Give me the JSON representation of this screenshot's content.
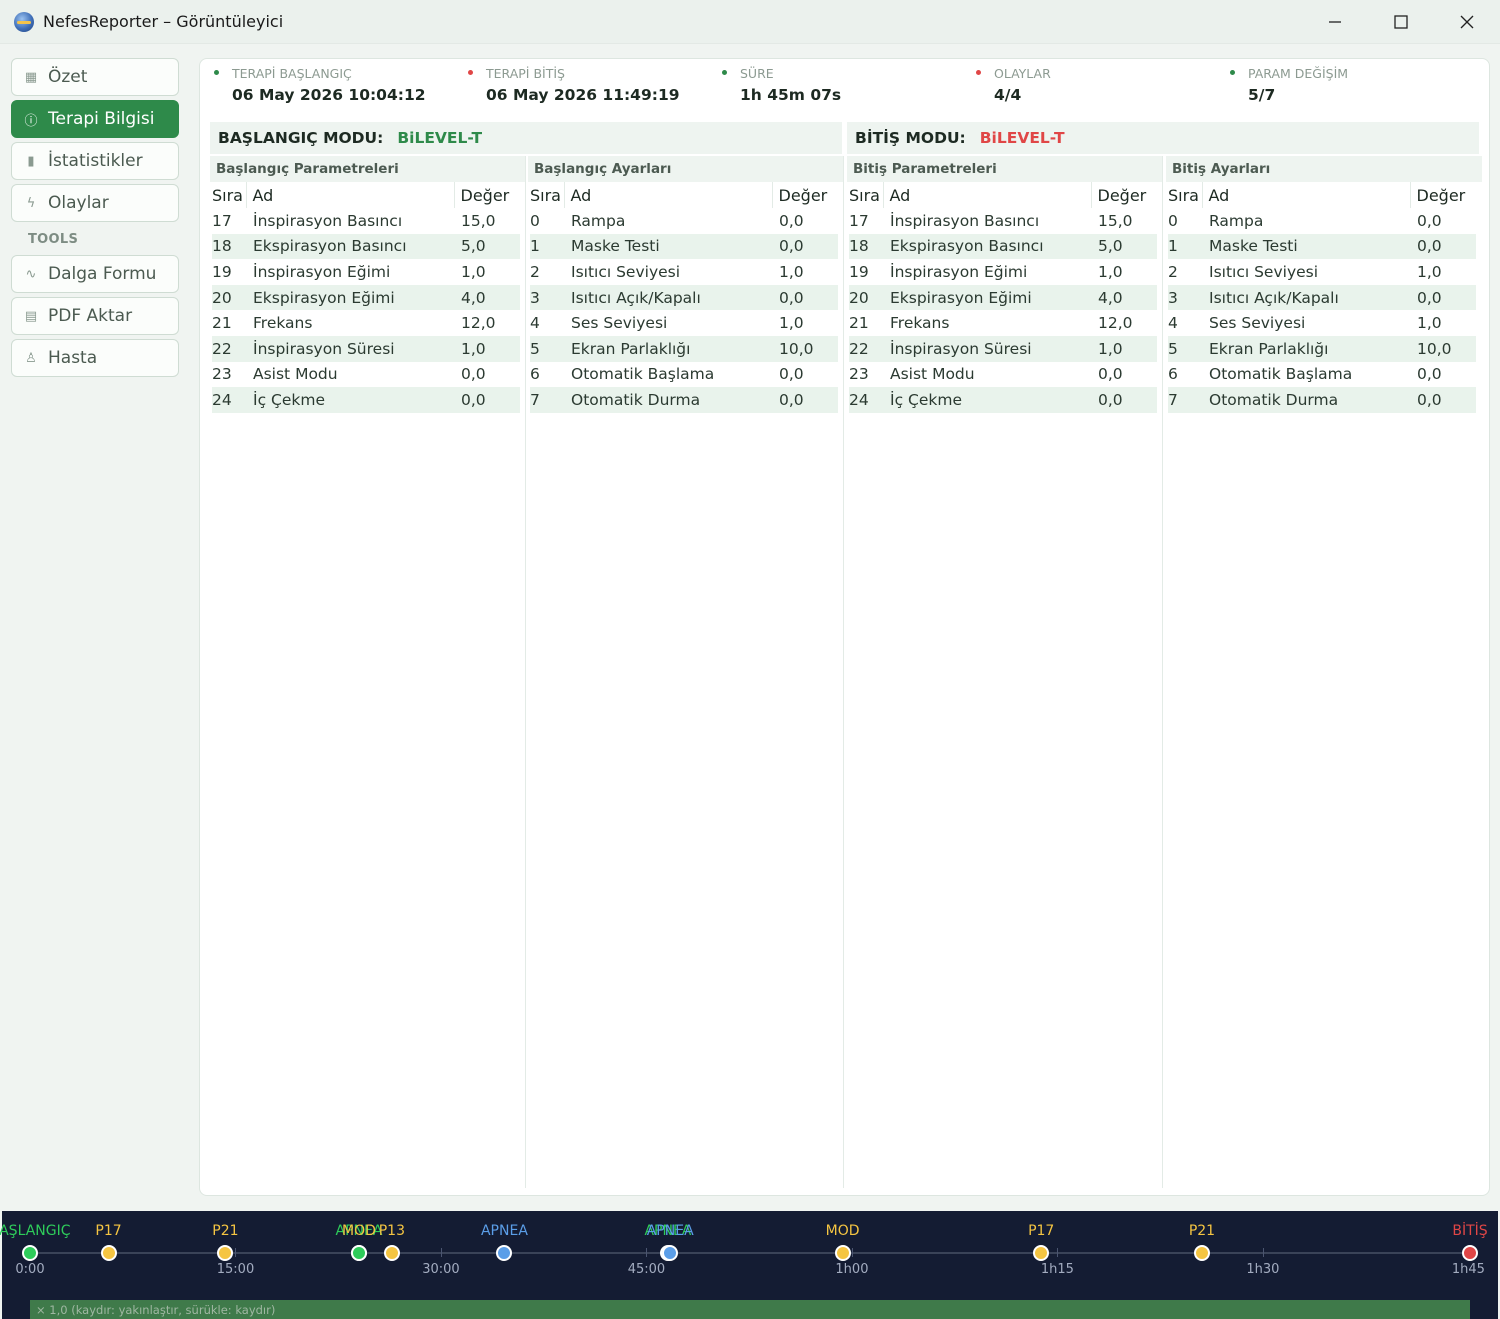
{
  "window": {
    "title": "NefesReporter – Görüntüleyici",
    "controls": {
      "minimize": "—",
      "maximize": "□",
      "close": "✕"
    }
  },
  "sidebar": {
    "items": [
      {
        "label": "Özet",
        "icon": "grid-icon",
        "active": false
      },
      {
        "label": "Terapi Bilgisi",
        "icon": "info-icon",
        "active": true
      },
      {
        "label": "İstatistikler",
        "icon": "bar-chart-icon",
        "active": false
      },
      {
        "label": "Olaylar",
        "icon": "lightning-icon",
        "active": false
      }
    ],
    "section_label": "TOOLS",
    "tools": [
      {
        "label": "Dalga Formu",
        "icon": "waveform-icon"
      },
      {
        "label": "PDF Aktar",
        "icon": "document-icon"
      },
      {
        "label": "Hasta",
        "icon": "person-icon"
      }
    ]
  },
  "stats": [
    {
      "label": "TERAPİ BAŞLANGIÇ",
      "value": "06 May 2026  10:04:12",
      "dot_color": "#2e8a4a"
    },
    {
      "label": "TERAPİ BİTİŞ",
      "value": "06 May 2026  11:49:19",
      "dot_color": "#e04646"
    },
    {
      "label": "SÜRE",
      "value": "1h 45m 07s",
      "dot_color": "#2e8a4a"
    },
    {
      "label": "OLAYLAR",
      "value": "4/4",
      "dot_color": "#e04646"
    },
    {
      "label": "PARAM DEĞİŞİM",
      "value": "5/7",
      "dot_color": "#2e8a4a"
    }
  ],
  "modes": {
    "start": {
      "label": "BAŞLANGIÇ MODU:",
      "value": "BiLEVEL-T",
      "color": "#2e8a4a"
    },
    "end": {
      "label": "BİTİŞ MODU:",
      "value": "BiLEVEL-T",
      "color": "#e04646"
    }
  },
  "tables": [
    {
      "title": "Başlangıç Parametreleri",
      "headers": [
        "Sıra",
        "Ad",
        "Değer"
      ],
      "rows": [
        [
          "17",
          "İnspirasyon Basıncı",
          "15,0"
        ],
        [
          "18",
          "Ekspirasyon Basıncı",
          "5,0"
        ],
        [
          "19",
          "İnspirasyon Eğimi",
          "1,0"
        ],
        [
          "20",
          "Ekspirasyon Eğimi",
          "4,0"
        ],
        [
          "21",
          "Frekans",
          "12,0"
        ],
        [
          "22",
          "İnspirasyon Süresi",
          "1,0"
        ],
        [
          "23",
          "Asist Modu",
          "0,0"
        ],
        [
          "24",
          "İç Çekme",
          "0,0"
        ]
      ]
    },
    {
      "title": "Başlangıç Ayarları",
      "headers": [
        "Sıra",
        "Ad",
        "Değer"
      ],
      "rows": [
        [
          "0",
          "Rampa",
          "0,0"
        ],
        [
          "1",
          "Maske Testi",
          "0,0"
        ],
        [
          "2",
          "Isıtıcı Seviyesi",
          "1,0"
        ],
        [
          "3",
          "Isıtıcı Açık/Kapalı",
          "0,0"
        ],
        [
          "4",
          "Ses Seviyesi",
          "1,0"
        ],
        [
          "5",
          "Ekran Parlaklığı",
          "10,0"
        ],
        [
          "6",
          "Otomatik Başlama",
          "0,0"
        ],
        [
          "7",
          "Otomatik Durma",
          "0,0"
        ]
      ]
    },
    {
      "title": "Bitiş Parametreleri",
      "headers": [
        "Sıra",
        "Ad",
        "Değer"
      ],
      "rows": [
        [
          "17",
          "İnspirasyon Basıncı",
          "15,0"
        ],
        [
          "18",
          "Ekspirasyon Basıncı",
          "5,0"
        ],
        [
          "19",
          "İnspirasyon Eğimi",
          "1,0"
        ],
        [
          "20",
          "Ekspirasyon Eğimi",
          "4,0"
        ],
        [
          "21",
          "Frekans",
          "12,0"
        ],
        [
          "22",
          "İnspirasyon Süresi",
          "1,0"
        ],
        [
          "23",
          "Asist Modu",
          "0,0"
        ],
        [
          "24",
          "İç Çekme",
          "0,0"
        ]
      ]
    },
    {
      "title": "Bitiş Ayarları",
      "headers": [
        "Sıra",
        "Ad",
        "Değer"
      ],
      "rows": [
        [
          "0",
          "Rampa",
          "0,0"
        ],
        [
          "1",
          "Maske Testi",
          "0,0"
        ],
        [
          "2",
          "Isıtıcı Seviyesi",
          "1,0"
        ],
        [
          "3",
          "Isıtıcı Açık/Kapalı",
          "0,0"
        ],
        [
          "4",
          "Ses Seviyesi",
          "1,0"
        ],
        [
          "5",
          "Ekran Parlaklığı",
          "10,0"
        ],
        [
          "6",
          "Otomatik Başlama",
          "0,0"
        ],
        [
          "7",
          "Otomatik Durma",
          "0,0"
        ]
      ]
    }
  ],
  "timeline": {
    "duration_seconds": 6307,
    "ticks": [
      {
        "label": "0:00",
        "seconds": 0
      },
      {
        "label": "15:00",
        "seconds": 900
      },
      {
        "label": "30:00",
        "seconds": 1800
      },
      {
        "label": "45:00",
        "seconds": 2700
      },
      {
        "label": "1h00",
        "seconds": 3600
      },
      {
        "label": "1h15",
        "seconds": 4500
      },
      {
        "label": "1h30",
        "seconds": 5400
      },
      {
        "label": "1h45",
        "seconds": 6300
      }
    ],
    "events": [
      {
        "label": "BAŞLANGIÇ",
        "seconds": 0,
        "color": "#2ecc5a",
        "label_color": "#2ecc5a"
      },
      {
        "label": "P17",
        "seconds": 344,
        "color": "#f5c542",
        "label_color": "#f5c542"
      },
      {
        "label": "P21",
        "seconds": 856,
        "color": "#f5c542",
        "label_color": "#f5c542"
      },
      {
        "label": "APNEA",
        "seconds": 1441,
        "color": "#2ecc5a",
        "label_color": "#2ecc5a"
      },
      {
        "label": "MOD",
        "seconds": 1441,
        "color": "#2ecc5a",
        "label_color": "#f5c542"
      },
      {
        "label": "P13",
        "seconds": 1585,
        "color": "#f5c542",
        "label_color": "#f5c542"
      },
      {
        "label": "APNEA",
        "seconds": 2078,
        "color": "#5b9ee8",
        "label_color": "#5b9ee8"
      },
      {
        "label": "APNEA",
        "seconds": 2794,
        "color": "#5b9ee8",
        "label_color": "#2ecc5a"
      },
      {
        "label": "APNEA",
        "seconds": 2804,
        "color": "#5b9ee8",
        "label_color": "#5b9ee8"
      },
      {
        "label": "MOD",
        "seconds": 3559,
        "color": "#f5c542",
        "label_color": "#f5c542"
      },
      {
        "label": "P17",
        "seconds": 4429,
        "color": "#f5c542",
        "label_color": "#f5c542"
      },
      {
        "label": "P21",
        "seconds": 5133,
        "color": "#f5c542",
        "label_color": "#f5c542"
      },
      {
        "label": "BİTİŞ",
        "seconds": 6307,
        "color": "#e04646",
        "label_color": "#e04646"
      }
    ],
    "zoom_text": "× 1,0  (kaydır: yakınlaştır, sürükle: kaydır)"
  }
}
